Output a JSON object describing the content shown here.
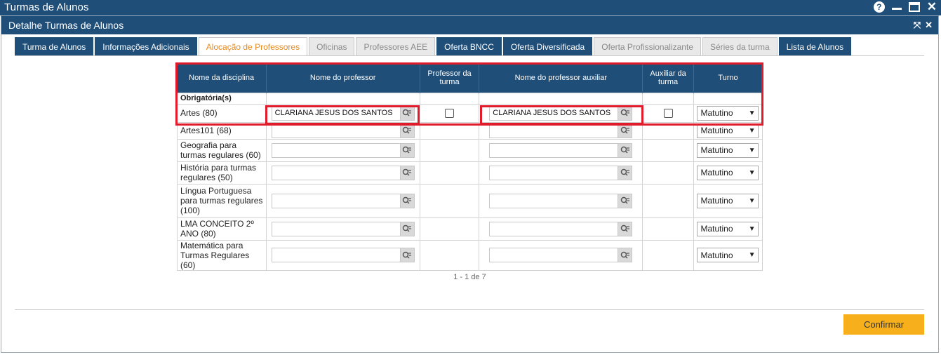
{
  "window": {
    "title": "Turmas de Alunos"
  },
  "panel": {
    "title": "Detalhe Turmas de Alunos"
  },
  "tabs": [
    {
      "label": "Turma de Alunos",
      "style": "dark"
    },
    {
      "label": "Informações Adicionais",
      "style": "dark"
    },
    {
      "label": "Alocação de Professores",
      "style": "active"
    },
    {
      "label": "Oficinas",
      "style": "light"
    },
    {
      "label": "Professores AEE",
      "style": "light"
    },
    {
      "label": "Oferta BNCC",
      "style": "dark"
    },
    {
      "label": "Oferta Diversificada",
      "style": "dark"
    },
    {
      "label": "Oferta Profissionalizante",
      "style": "light"
    },
    {
      "label": "Séries da turma",
      "style": "light"
    },
    {
      "label": "Lista de Alunos",
      "style": "dark"
    }
  ],
  "table": {
    "headers": {
      "disciplina": "Nome da disciplina",
      "professor": "Nome do professor",
      "professor_turma": "Professor da turma",
      "auxiliar": "Nome do professor auxiliar",
      "auxiliar_turma": "Auxiliar da turma",
      "turno": "Turno"
    },
    "group_label": "Obrigatória(s)",
    "rows": [
      {
        "disciplina": "Artes (80)",
        "professor": "CLARIANA JESUS DOS SANTOS",
        "professor_turma": false,
        "auxiliar": "CLARIANA JESUS DOS SANTOS",
        "auxiliar_turma": false,
        "show_checkboxes": true,
        "turno": "Matutino"
      },
      {
        "disciplina": "Artes101 (68)",
        "professor": "",
        "auxiliar": "",
        "show_checkboxes": false,
        "turno": "Matutino"
      },
      {
        "disciplina": "Geografia para turmas regulares (60)",
        "professor": "",
        "auxiliar": "",
        "show_checkboxes": false,
        "turno": "Matutino"
      },
      {
        "disciplina": "História para turmas regulares (50)",
        "professor": "",
        "auxiliar": "",
        "show_checkboxes": false,
        "turno": "Matutino"
      },
      {
        "disciplina": "Língua Portuguesa para turmas regulares (100)",
        "professor": "",
        "auxiliar": "",
        "show_checkboxes": false,
        "turno": "Matutino"
      },
      {
        "disciplina": "LMA CONCEITO 2º ANO (80)",
        "professor": "",
        "auxiliar": "",
        "show_checkboxes": false,
        "turno": "Matutino"
      },
      {
        "disciplina": "Matemática para Turmas Regulares (60)",
        "professor": "",
        "auxiliar": "",
        "show_checkboxes": false,
        "turno": "Matutino"
      }
    ]
  },
  "pager": {
    "text": "1 - 1 de 7"
  },
  "actions": {
    "confirm_label": "Confirmar"
  },
  "colors": {
    "header_bg": "#1f4e79",
    "active_tab_text": "#e58a1f",
    "confirm_bg": "#f7b01c",
    "highlight": "#e21b2c"
  }
}
